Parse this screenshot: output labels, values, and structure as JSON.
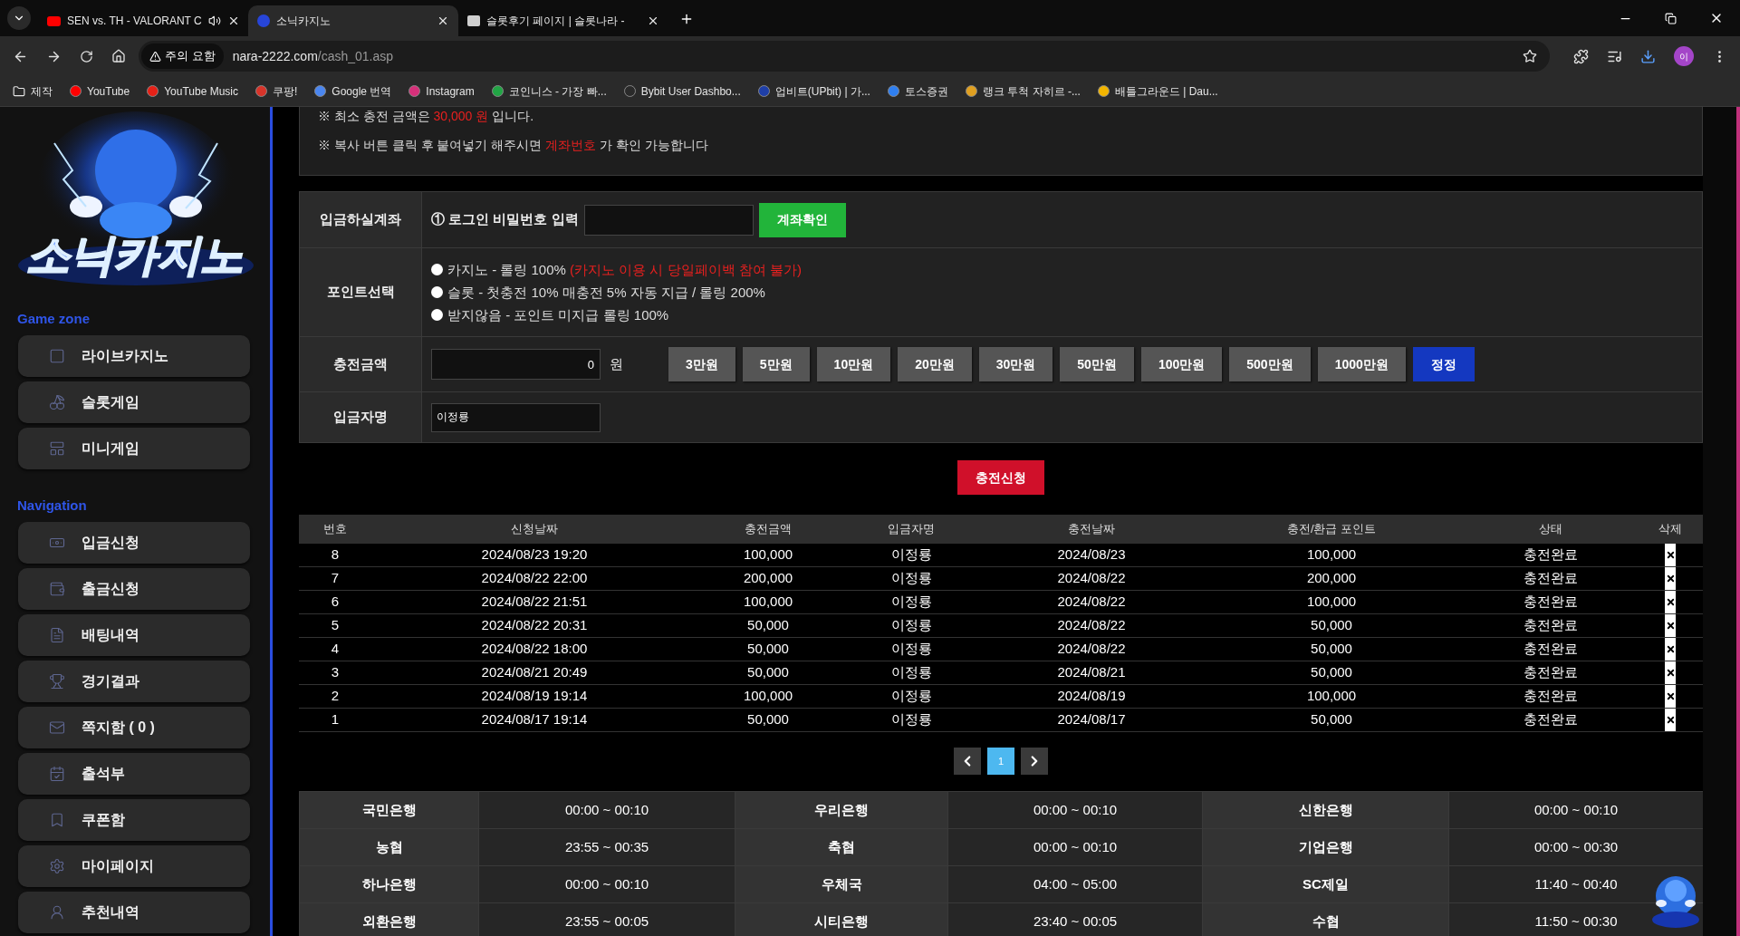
{
  "browser": {
    "tabs": [
      {
        "title": "SEN vs. TH - VALORANT C",
        "selected": false,
        "audio": true
      },
      {
        "title": "소닉카지노",
        "selected": true,
        "audio": false
      },
      {
        "title": "슬롯후기 페이지 | 슬롯나라 -",
        "selected": false,
        "audio": false
      }
    ],
    "address": {
      "warning": "주의 요함",
      "domain": "nara-2222.com",
      "path": "/cash_01.asp"
    },
    "profile": "이",
    "bookmarks": [
      {
        "kind": "folder",
        "title": "제작"
      },
      {
        "kind": "site",
        "title": "YouTube",
        "color": "#ff0000"
      },
      {
        "kind": "site",
        "title": "YouTube Music",
        "color": "#e62117"
      },
      {
        "kind": "site",
        "title": "쿠팡!",
        "color": "#d8342a"
      },
      {
        "kind": "site",
        "title": "Google 번역",
        "color": "#4a86f0"
      },
      {
        "kind": "site",
        "title": "Instagram",
        "color": "#d6307a"
      },
      {
        "kind": "site",
        "title": "코인니스 - 가장 빠...",
        "color": "#22a545"
      },
      {
        "kind": "site",
        "title": "Bybit User Dashbo...",
        "color": "#2a2a2a"
      },
      {
        "kind": "site",
        "title": "업비트(UPbit) | 가...",
        "color": "#1f3fa8"
      },
      {
        "kind": "site",
        "title": "토스증권",
        "color": "#2f7ff0"
      },
      {
        "kind": "site",
        "title": "랭크 투척 자히르 -...",
        "color": "#e0a020"
      },
      {
        "kind": "site",
        "title": "배틀그라운드 | Dau...",
        "color": "#f2b500"
      }
    ]
  },
  "sidebar": {
    "logo_text": "소닉카지노",
    "sections": [
      {
        "title": "Game zone",
        "items": [
          "라이브카지노",
          "슬롯게임",
          "미니게임"
        ]
      },
      {
        "title": "Navigation",
        "items": [
          "입금신청",
          "출금신청",
          "배팅내역",
          "경기결과",
          "쪽지함 ( 0 )",
          "출석부",
          "쿠폰함",
          "마이페이지",
          "추천내역"
        ]
      }
    ]
  },
  "notices": [
    {
      "text": "※ 최소 충전 금액은 ",
      "highlight": "30,000 원",
      "after": " 입니다."
    },
    {
      "text": "※ 복사 버튼 클릭 후 붙여넣기 해주시면 ",
      "highlight": "계좌번호",
      "after": " 가 확인 가능합니다"
    }
  ],
  "form": {
    "account": {
      "label": "입금하실계좌",
      "step": "①",
      "prompt": "로그인 비밀번호 입력",
      "button": "계좌확인"
    },
    "points": {
      "label": "포인트선택",
      "options": [
        {
          "text": "카지노 - 롤링 100%",
          "note": "(카지노 이용 시 당일페이백 참여 불가)",
          "selected": false
        },
        {
          "text": "슬롯 - 첫충전 10% 매충전 5% 자동 지급 / 롤링 200%",
          "selected": false
        },
        {
          "text": "받지않음 - 포인트 미지급 롤링 100%",
          "selected": false
        }
      ]
    },
    "amount": {
      "label": "충전금액",
      "value": "0",
      "unit": "원",
      "presets": [
        "3만원",
        "5만원",
        "10만원",
        "20만원",
        "30만원",
        "50만원",
        "100만원",
        "500만원",
        "1000만원"
      ],
      "reset": "정정"
    },
    "depositor": {
      "label": "입금자명",
      "value": "이정룡"
    }
  },
  "submit": "충전신청",
  "history": {
    "columns": [
      "번호",
      "신청날짜",
      "충전금액",
      "입금자명",
      "충전날짜",
      "충전/환급 포인트",
      "상태",
      "삭제"
    ],
    "rows": [
      [
        "8",
        "2024/08/23 19:20",
        "100,000",
        "이정룡",
        "2024/08/23",
        "100,000",
        "충전완료"
      ],
      [
        "7",
        "2024/08/22 22:00",
        "200,000",
        "이정룡",
        "2024/08/22",
        "200,000",
        "충전완료"
      ],
      [
        "6",
        "2024/08/22 21:51",
        "100,000",
        "이정룡",
        "2024/08/22",
        "100,000",
        "충전완료"
      ],
      [
        "5",
        "2024/08/22 20:31",
        "50,000",
        "이정룡",
        "2024/08/22",
        "50,000",
        "충전완료"
      ],
      [
        "4",
        "2024/08/22 18:00",
        "50,000",
        "이정룡",
        "2024/08/22",
        "50,000",
        "충전완료"
      ],
      [
        "3",
        "2024/08/21 20:49",
        "50,000",
        "이정룡",
        "2024/08/21",
        "50,000",
        "충전완료"
      ],
      [
        "2",
        "2024/08/19 19:14",
        "100,000",
        "이정룡",
        "2024/08/19",
        "100,000",
        "충전완료"
      ],
      [
        "1",
        "2024/08/17 19:14",
        "50,000",
        "이정룡",
        "2024/08/17",
        "50,000",
        "충전완료"
      ]
    ]
  },
  "pagination": {
    "pages": [
      {
        "label": "1",
        "selected": true
      }
    ]
  },
  "banks": [
    [
      "국민은행",
      "00:00 ~ 00:10",
      "우리은행",
      "00:00 ~ 00:10",
      "신한은행",
      "00:00 ~ 00:10"
    ],
    [
      "농협",
      "23:55 ~ 00:35",
      "축협",
      "00:00 ~ 00:10",
      "기업은행",
      "00:00 ~ 00:30"
    ],
    [
      "하나은행",
      "00:00 ~ 00:10",
      "우체국",
      "04:00 ~ 05:00",
      "SC제일",
      "11:40 ~ 00:40"
    ],
    [
      "외환은행",
      "23:55 ~ 00:05",
      "시티은행",
      "23:40 ~ 00:05",
      "수협",
      "11:50 ~ 00:30"
    ]
  ]
}
